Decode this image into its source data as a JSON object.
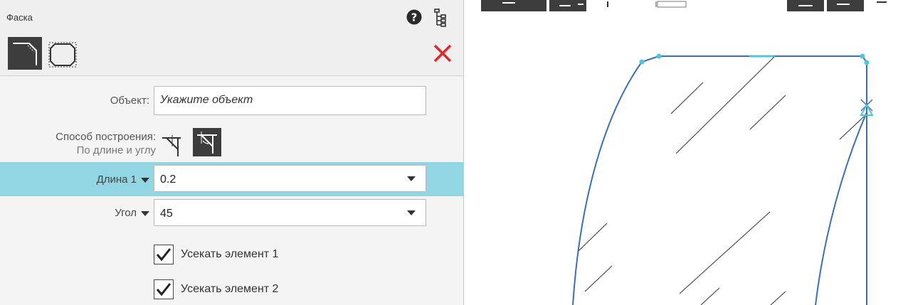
{
  "panel": {
    "title": "Фаска",
    "object_label": "Объект:",
    "object_placeholder": "Укажите объект",
    "method_label": "Способ построения:",
    "method_value": "По длине и углу",
    "length": {
      "label": "Длина 1",
      "value": "0.2"
    },
    "angle": {
      "label": "Угол",
      "value": "45"
    },
    "checkboxes": [
      {
        "label": "Усекать элемент 1",
        "checked": true
      },
      {
        "label": "Усекать элемент 2",
        "checked": true
      }
    ]
  },
  "icons": {
    "help": "help-icon",
    "tree": "tree-icon",
    "close": "close-icon",
    "chamfer_mode": "chamfer-mode-icon",
    "contour_mode": "contour-mode-icon"
  },
  "colors": {
    "highlight_row": "#93d6e3",
    "close": "#e0282b",
    "geometry": "#3a6fb5",
    "selection": "#4fc6d8"
  }
}
